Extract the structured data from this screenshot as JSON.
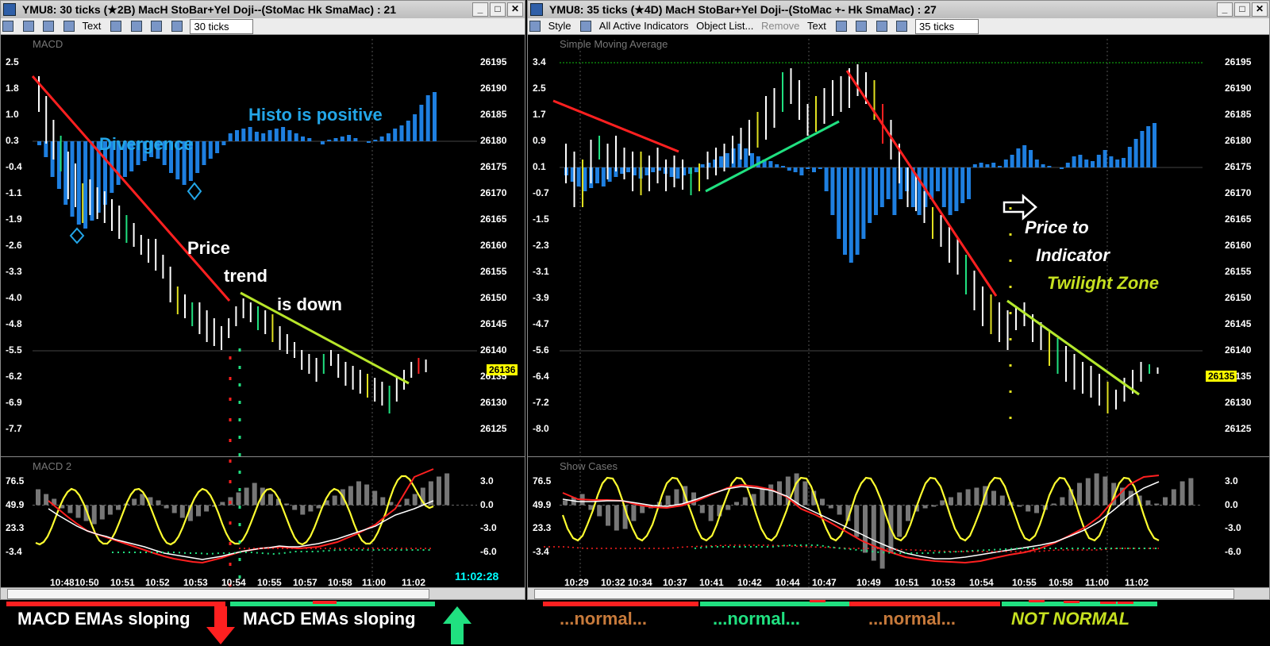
{
  "left_window": {
    "title": "YMU8: 30 ticks (★2B) MacH  StoBar+Yel Doji--(StoMac Hk SmaMac) : 21",
    "toolbar": {
      "text_label": "Text",
      "interval_value": "30 ticks"
    },
    "upper_panel": {
      "title": "MACD",
      "left_axis": [
        "2.5",
        "1.8",
        "1.0",
        "0.3",
        "-0.4",
        "-1.1",
        "-1.9",
        "-2.6",
        "-3.3",
        "-4.0",
        "-4.8",
        "-5.5",
        "-6.2",
        "-6.9",
        "-7.7"
      ],
      "right_axis": [
        "26195",
        "26190",
        "26185",
        "26180",
        "26175",
        "26170",
        "26165",
        "26160",
        "26155",
        "26150",
        "26145",
        "26140",
        "26135",
        "26130",
        "26125"
      ],
      "last_price": "26136",
      "annotations": {
        "divergence": "Divergence",
        "histo": "Histo is positive",
        "price": "Price",
        "trend": "trend",
        "is_down": "is down"
      }
    },
    "lower_panel": {
      "title": "MACD 2",
      "left_axis": [
        "76.5",
        "49.9",
        "23.3",
        "-3.4"
      ],
      "right_axis": [
        "3.0",
        "0.0",
        "-3.0",
        "-6.0"
      ]
    },
    "time_axis": [
      "10:48",
      "10:50",
      "10:51",
      "10:52",
      "10:53",
      "10:54",
      "10:55",
      "10:57",
      "10:58",
      "11:00",
      "11:02"
    ],
    "clock": "11:02:28"
  },
  "right_window": {
    "title": "YMU8: 35 ticks (★4D) MacH  StoBar+Yel Doji--(StoMac +- Hk SmaMac) : 27",
    "toolbar": {
      "style_label": "Style",
      "all_indicators_label": "All Active Indicators",
      "object_list_label": "Object List...",
      "remove_label": "Remove",
      "text_label": "Text",
      "interval_value": "35 ticks"
    },
    "upper_panel": {
      "title": "Simple Moving Average",
      "left_axis": [
        "3.4",
        "2.5",
        "1.7",
        "0.9",
        "0.1",
        "-0.7",
        "-1.5",
        "-2.3",
        "-3.1",
        "-3.9",
        "-4.7",
        "-5.6",
        "-6.4",
        "-7.2",
        "-8.0"
      ],
      "right_axis": [
        "26195",
        "26190",
        "26185",
        "26180",
        "26175",
        "26170",
        "26165",
        "26160",
        "26155",
        "26150",
        "26145",
        "26140",
        "26135",
        "26130",
        "26125"
      ],
      "last_price": "26135",
      "annotations": {
        "price_to": "Price to",
        "indicator": "Indicator",
        "twilight": "Twilight Zone"
      }
    },
    "lower_panel": {
      "title": "Show Cases",
      "left_axis": [
        "76.5",
        "49.9",
        "23.3",
        "-3.4"
      ],
      "right_axis": [
        "3.0",
        "0.0",
        "-3.0",
        "-6.0"
      ]
    },
    "time_axis": [
      "10:29",
      "10:32",
      "10:34",
      "10:37",
      "10:41",
      "10:42",
      "10:44",
      "10:47",
      "10:49",
      "10:51",
      "10:53",
      "10:54",
      "10:55",
      "10:58",
      "11:00",
      "11:02"
    ]
  },
  "bottom_labels": {
    "left_down": "MACD EMAs sloping",
    "left_up": "MACD EMAs sloping",
    "normal_1": "...normal...",
    "normal_2": "...normal...",
    "normal_3": "...normal...",
    "not_normal": "NOT NORMAL"
  },
  "colors": {
    "histogram": "#1e7fe0",
    "price_bar": "#ffffff",
    "trend_down": "#ff2020",
    "trend_line": "#b8e62a",
    "green_line": "#20e080",
    "stochastic": "#ffff30",
    "annotation_blue": "#23a6e8",
    "arrow_red": "#ff2020",
    "arrow_green": "#20e080",
    "normal_text": "#c77a3b",
    "not_normal_text": "#c6e020"
  }
}
